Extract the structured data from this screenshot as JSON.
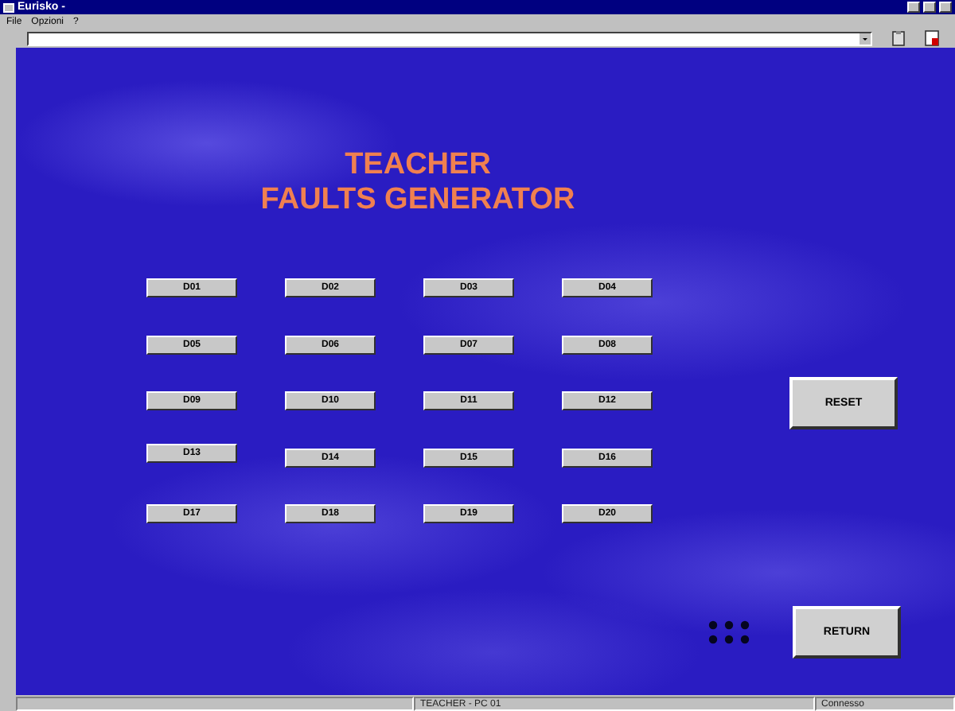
{
  "window": {
    "title": "Eurisko -"
  },
  "menu": [
    "File",
    "Opzioni",
    "?"
  ],
  "heading": [
    "TEACHER",
    "FAULTS GENERATOR"
  ],
  "fault_buttons": [
    "D01",
    "D02",
    "D03",
    "D04",
    "D05",
    "D06",
    "D07",
    "D08",
    "D09",
    "D10",
    "D11",
    "D12",
    "D13",
    "D14",
    "D15",
    "D16",
    "D17",
    "D18",
    "D19",
    "D20"
  ],
  "side_buttons": [
    "RESET",
    "RETURN"
  ],
  "status_bar": [
    "TEACHER - PC 01",
    "Connesso"
  ]
}
